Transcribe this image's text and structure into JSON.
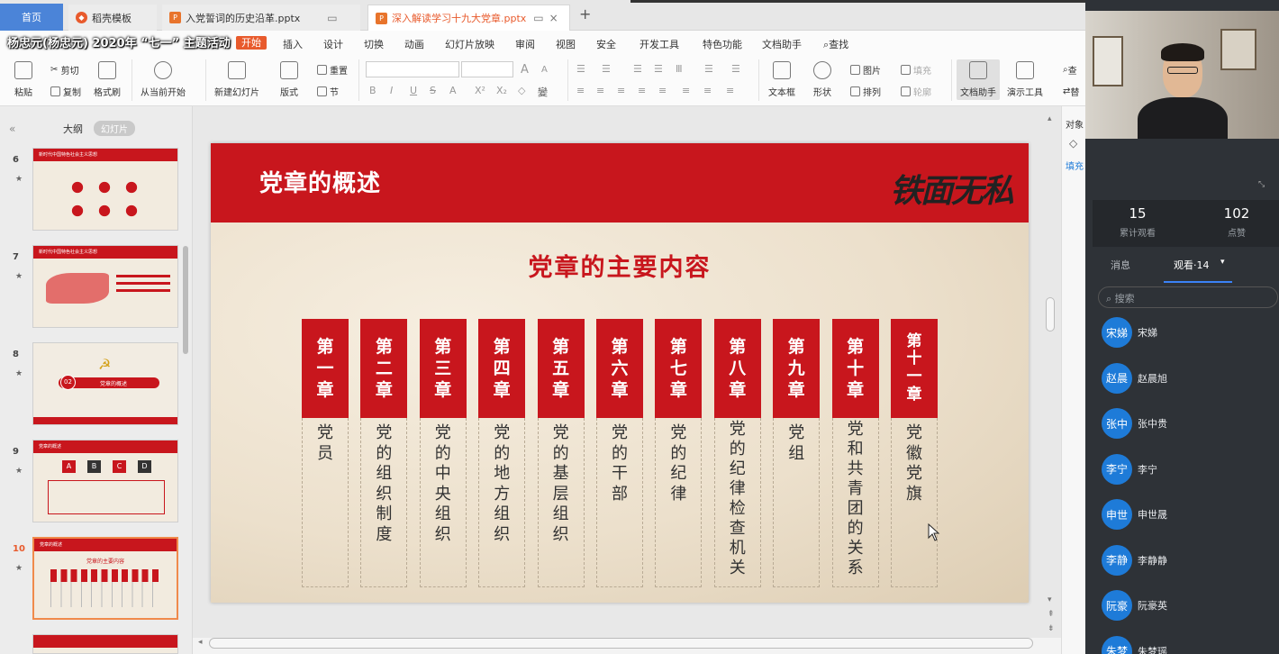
{
  "tabs": {
    "home": "首页",
    "templates": "稻壳模板",
    "file1": "入党誓词的历史沿革.pptx",
    "file2": "深入解读学习十九大党章.pptx",
    "close": "×",
    "add": "+"
  },
  "overlay_title": "杨忠元(杨忠元)  2020年  “七一”  主题活动",
  "menu": {
    "items": [
      "插入",
      "设计",
      "切换",
      "动画",
      "幻灯片放映",
      "审阅",
      "视图",
      "安全",
      "开发工具",
      "特色功能",
      "文档助手"
    ],
    "search": "查找",
    "active": "开始"
  },
  "ribbon": {
    "paste": "粘贴",
    "cut": "剪切",
    "copy": "复制",
    "format_painter": "格式刷",
    "from_start": "从当前开始",
    "new_slide": "新建幻灯片",
    "layout": "版式",
    "reset": "重置",
    "section": "节",
    "font_a_large": "A",
    "font_a_small": "A",
    "text_box": "文本框",
    "shape": "形状",
    "picture": "图片",
    "fill": "填充",
    "arrange": "排列",
    "outline": "轮廓",
    "doc_helper": "文档助手",
    "presentation_tools": "演示工具",
    "find": "查",
    "replace": "替"
  },
  "left_panel": {
    "collapse": "«",
    "outline_tab": "大纲",
    "slides_tab": "幻灯片",
    "thumbs": [
      {
        "num": "6",
        "label": "新时代中国特色社会主义思想"
      },
      {
        "num": "7",
        "label": "新时代中国特色社会主义思想"
      },
      {
        "num": "8",
        "label": "党章的概述"
      },
      {
        "num": "9",
        "label": "党章的概述"
      },
      {
        "num": "10",
        "label": "党章的概述"
      }
    ],
    "thumb8_badge": "02",
    "thumb9_letters": [
      "A",
      "B",
      "C",
      "D"
    ],
    "thumb10_heading": "党章的主要内容",
    "star": "★"
  },
  "slide": {
    "title": "党章的概述",
    "logo": "铁面无私",
    "heading": "党章的主要内容",
    "chapters": [
      {
        "top": [
          "第",
          "一",
          "章"
        ],
        "bottom": [
          "党",
          "员"
        ]
      },
      {
        "top": [
          "第",
          "二",
          "章"
        ],
        "bottom": [
          "党",
          "的",
          "组",
          "织",
          "制",
          "度"
        ]
      },
      {
        "top": [
          "第",
          "三",
          "章"
        ],
        "bottom": [
          "党",
          "的",
          "中",
          "央",
          "组",
          "织"
        ]
      },
      {
        "top": [
          "第",
          "四",
          "章"
        ],
        "bottom": [
          "党",
          "的",
          "地",
          "方",
          "组",
          "织"
        ]
      },
      {
        "top": [
          "第",
          "五",
          "章"
        ],
        "bottom": [
          "党",
          "的",
          "基",
          "层",
          "组",
          "织"
        ]
      },
      {
        "top": [
          "第",
          "六",
          "章"
        ],
        "bottom": [
          "党",
          "的",
          "干",
          "部"
        ]
      },
      {
        "top": [
          "第",
          "七",
          "章"
        ],
        "bottom": [
          "党",
          "的",
          "纪",
          "律"
        ]
      },
      {
        "top": [
          "第",
          "八",
          "章"
        ],
        "bottom": [
          "党",
          "的",
          "纪",
          "律",
          "检",
          "查",
          "机",
          "关"
        ]
      },
      {
        "top": [
          "第",
          "九",
          "章"
        ],
        "bottom": [
          "党",
          "组"
        ]
      },
      {
        "top": [
          "第",
          "十",
          "章"
        ],
        "bottom": [
          "党",
          "和",
          "共",
          "青",
          "团",
          "的",
          "关",
          "系"
        ]
      },
      {
        "top": [
          "第",
          "十",
          "一",
          "章"
        ],
        "bottom": [
          "党",
          "徽",
          "党",
          "旗"
        ]
      }
    ]
  },
  "props": {
    "object": "对象",
    "fill": "填充"
  },
  "live": {
    "stats": [
      {
        "num": "15",
        "label": "累计观看"
      },
      {
        "num": "102",
        "label": "点赞"
      }
    ],
    "tabs": {
      "messages": "消息",
      "viewers": "观看·14",
      "dropdown": "▾"
    },
    "search_placeholder": "搜索",
    "viewers": [
      {
        "avatar": "宋娣",
        "name": "宋娣"
      },
      {
        "avatar": "赵晨",
        "name": "赵晨旭"
      },
      {
        "avatar": "张中",
        "name": "张中贵"
      },
      {
        "avatar": "李宁",
        "name": "李宁"
      },
      {
        "avatar": "申世",
        "name": "申世晟"
      },
      {
        "avatar": "李静",
        "name": "李静静"
      },
      {
        "avatar": "阮豪",
        "name": "阮豪英"
      },
      {
        "avatar": "朱梦",
        "name": "朱梦瑶"
      }
    ]
  },
  "colors": {
    "party_red": "#c8161d",
    "wps_orange": "#e85a2c",
    "home_blue": "#4b84d8",
    "avatar_blue": "#1e7bd8"
  }
}
